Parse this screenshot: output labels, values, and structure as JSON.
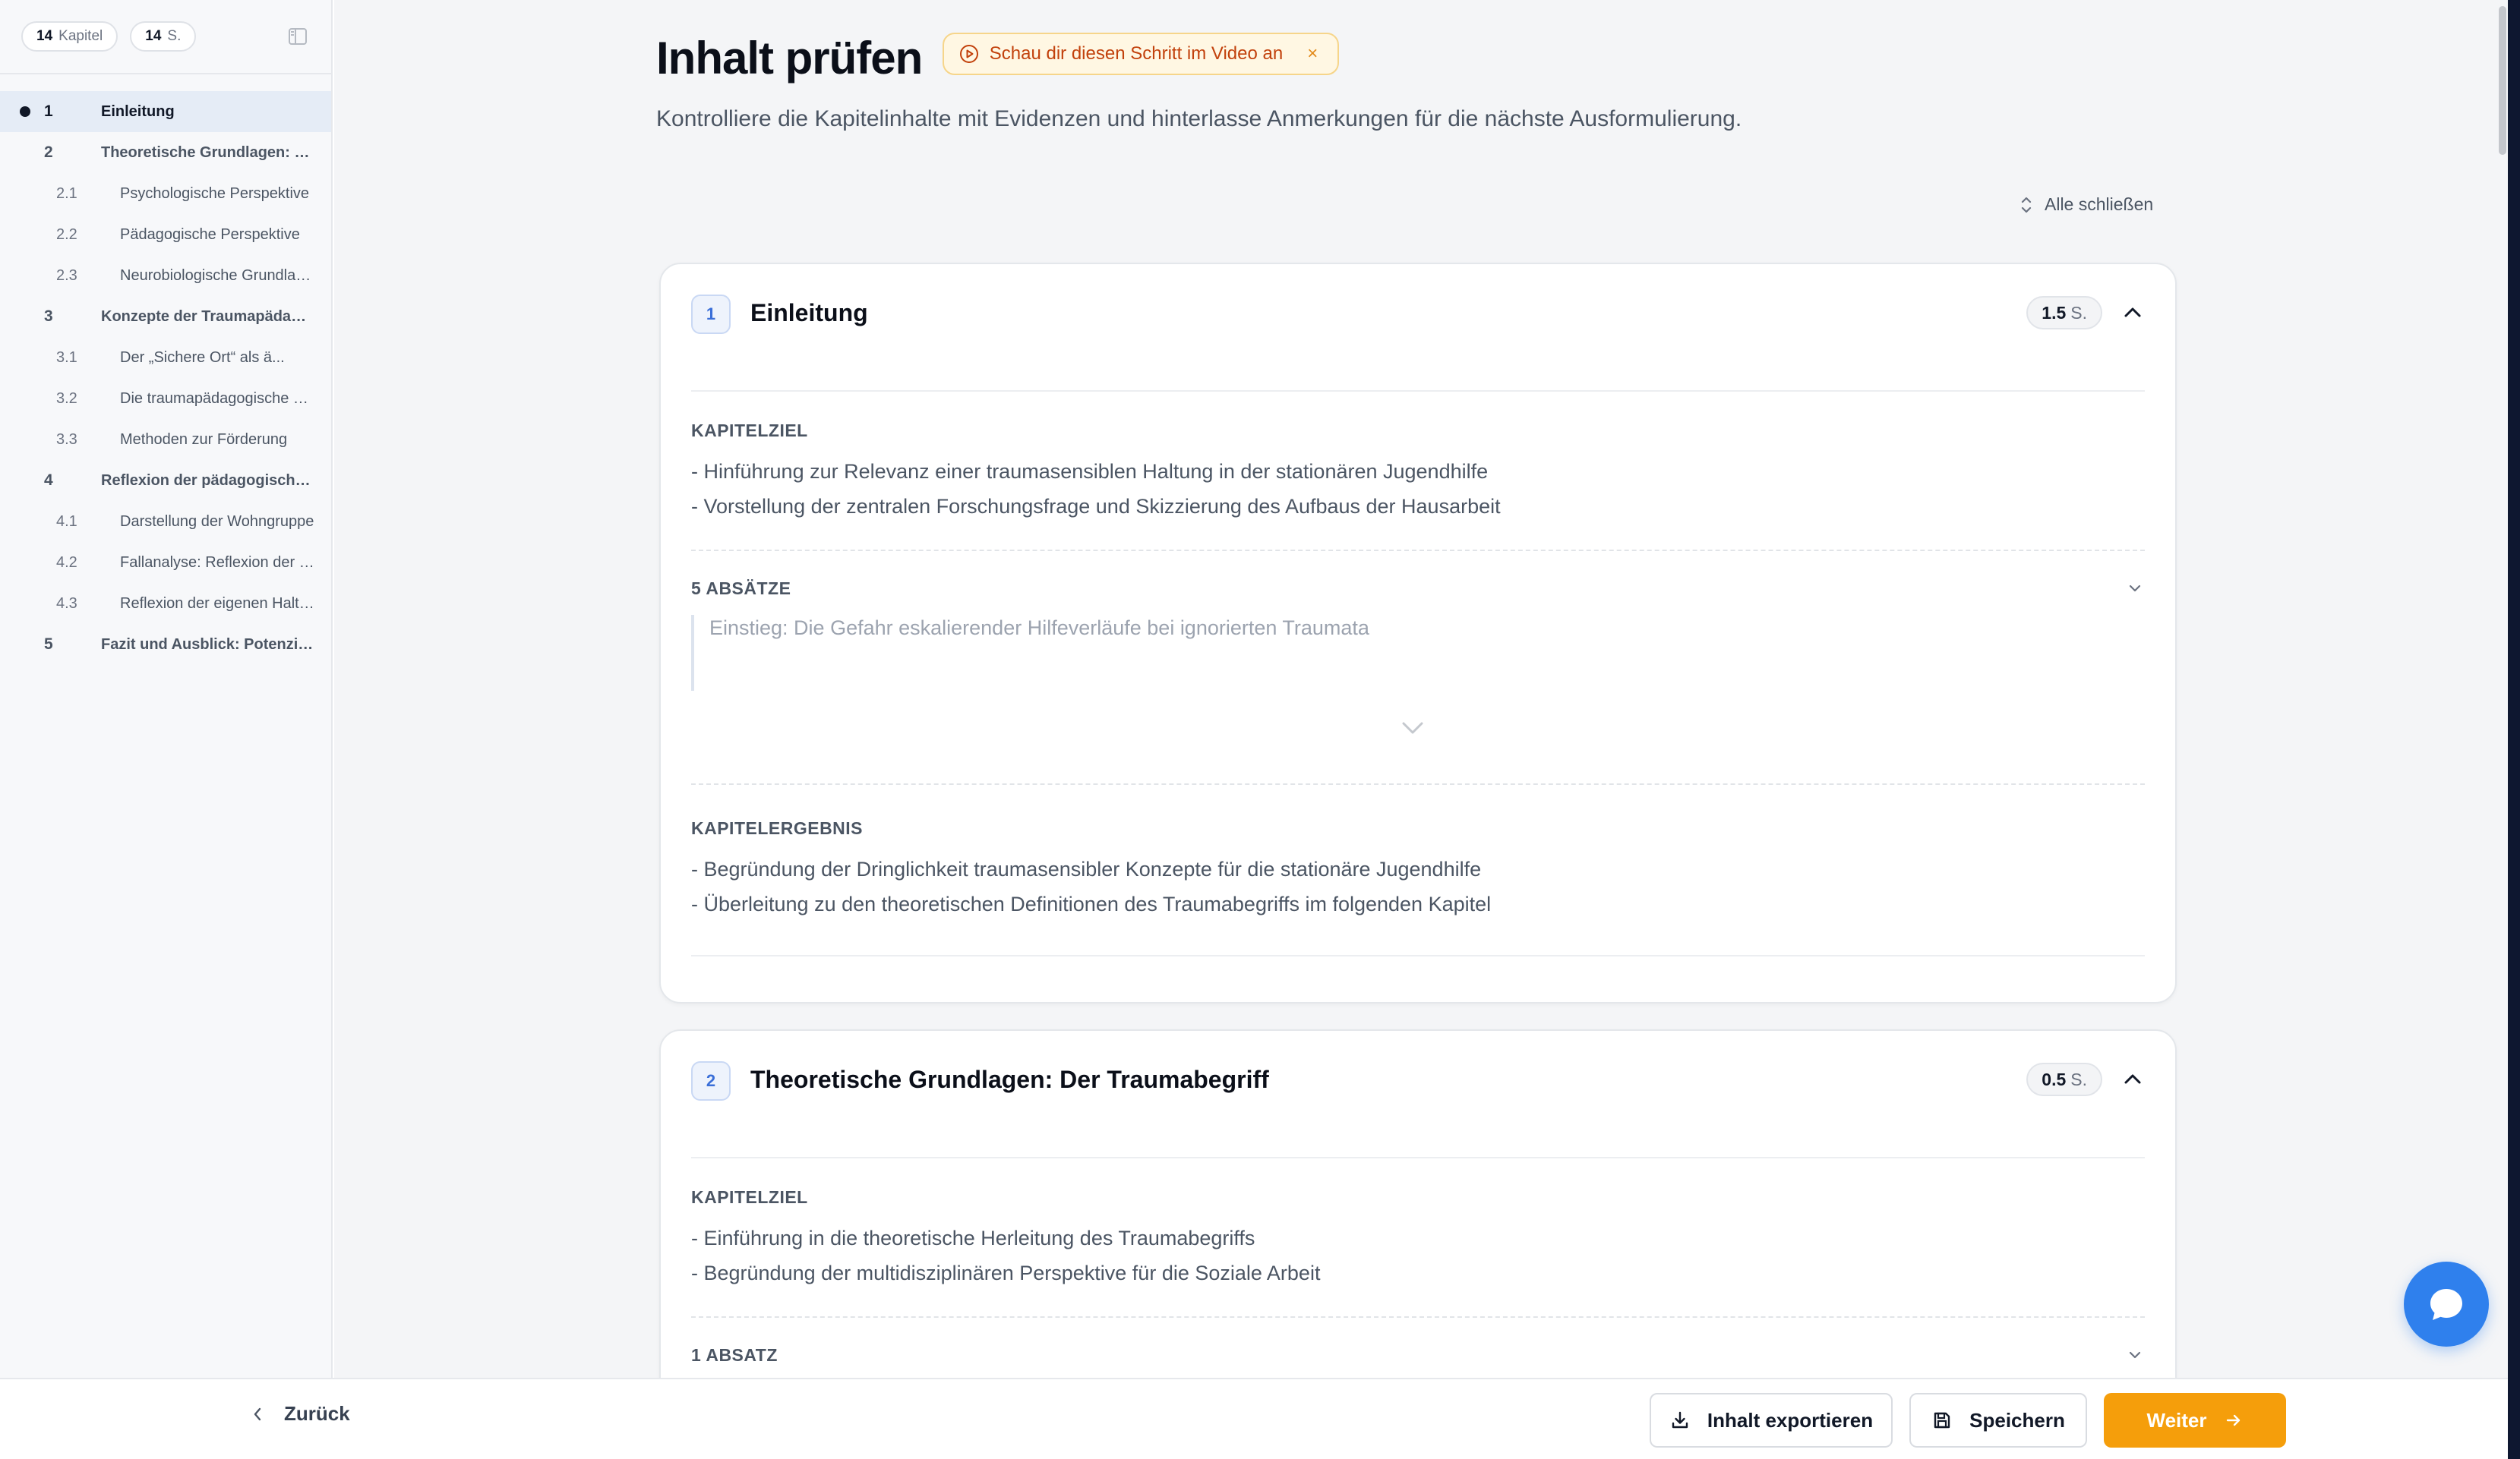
{
  "sidebar": {
    "chapters_count": "14",
    "chapters_label": "Kapitel",
    "pages_count": "14",
    "pages_label": "S.",
    "items": [
      {
        "num": "1",
        "title": "Einleitung"
      },
      {
        "num": "2",
        "title": "Theoretische Grundlagen: Der Traumabegriff"
      },
      {
        "num": "2.1",
        "title": "Psychologische Perspektive"
      },
      {
        "num": "2.2",
        "title": "Pädagogische Perspektive"
      },
      {
        "num": "2.3",
        "title": "Neurobiologische Grundlagen"
      },
      {
        "num": "3",
        "title": "Konzepte der Traumapädagogik"
      },
      {
        "num": "3.1",
        "title": "Der „Sichere Ort“ als ä..."
      },
      {
        "num": "3.2",
        "title": "Die traumapädagogische Haltung"
      },
      {
        "num": "3.3",
        "title": "Methoden zur Förderung"
      },
      {
        "num": "4",
        "title": "Reflexion der pädagogischen Praxis"
      },
      {
        "num": "4.1",
        "title": "Darstellung der Wohngruppe"
      },
      {
        "num": "4.2",
        "title": "Fallanalyse: Reflexion der Praxis"
      },
      {
        "num": "4.3",
        "title": "Reflexion der eigenen Haltung"
      },
      {
        "num": "5",
        "title": "Fazit und Ausblick: Potenziale"
      }
    ]
  },
  "header": {
    "title": "Inhalt prüfen",
    "video_chip": "Schau dir diesen Schritt im Video an",
    "video_close": "×",
    "subtitle": "Kontrolliere die Kapitelinhalte mit Evidenzen und hinterlasse Anmerkungen für die nächste Ausformulierung.",
    "collapse_all": "Alle schließen"
  },
  "chapters": [
    {
      "num": "1",
      "title": "Einleitung",
      "pages": "1.5",
      "pages_unit": "S.",
      "goal_label": "KAPITELZIEL",
      "goals": [
        "- Hinführung zur Relevanz einer traumasensiblen Haltung in der stationären Jugendhilfe",
        "- Vorstellung der zentralen Forschungsfrage und Skizzierung des Aufbaus der Hausarbeit"
      ],
      "paragraphs_label": "5 ABSÄTZE",
      "paragraph_preview": "Einstieg: Die Gefahr eskalierender Hilfeverläufe bei ignorierten Traumata",
      "result_label": "KAPITELERGEBNIS",
      "results": [
        "- Begründung der Dringlichkeit traumasensibler Konzepte für die stationäre Jugendhilfe",
        "- Überleitung zu den theoretischen Definitionen des Traumabegriffs im folgenden Kapitel"
      ]
    },
    {
      "num": "2",
      "title": "Theoretische Grundlagen: Der Traumabegriff",
      "pages": "0.5",
      "pages_unit": "S.",
      "goal_label": "KAPITELZIEL",
      "goals": [
        "- Einführung in die theoretische Herleitung des Traumabegriffs",
        "- Begründung der multidisziplinären Perspektive für die Soziale Arbeit"
      ],
      "paragraphs_label": "1 ABSATZ"
    }
  ],
  "footer": {
    "back": "Zurück",
    "export": "Inhalt exportieren",
    "save": "Speichern",
    "next": "Weiter"
  },
  "colors": {
    "accent": "#f59e0b",
    "chat": "#2f80ed",
    "chip_text": "#c2410c"
  }
}
